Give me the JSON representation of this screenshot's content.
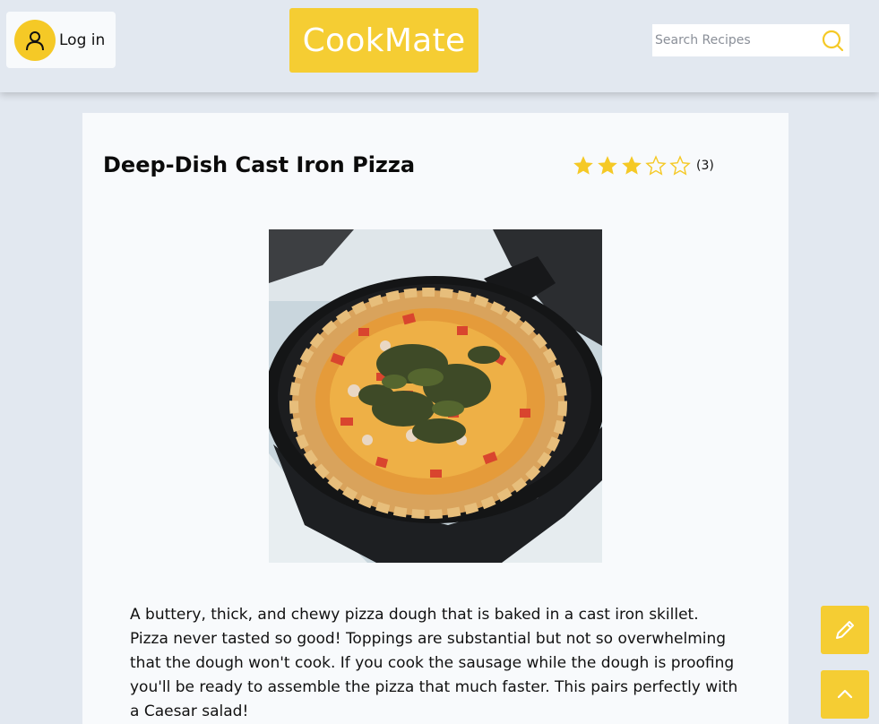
{
  "header": {
    "login_label": "Log in",
    "logo_text": "CookMate",
    "search_placeholder": "Search Recipes",
    "search_value": ""
  },
  "recipe": {
    "title": "Deep-Dish Cast Iron Pizza",
    "rating": 3,
    "rating_max": 5,
    "rating_count": "(3)",
    "image_subject": "deep-dish pizza in cast iron skillet",
    "description": "A buttery, thick, and chewy pizza dough that is baked in a cast iron skillet. Pizza never tasted so good! Toppings are substantial but not so overwhelming that the dough won't cook. If you cook the sausage while the dough is proofing you'll be ready to assemble the pizza that much faster. This pairs perfectly with a Caesar salad!"
  },
  "icons": {
    "login": "user-icon",
    "search": "search-icon",
    "edit": "pencil-icon",
    "scroll_top": "chevron-up-icon",
    "star_filled": "star-filled-icon",
    "star_empty": "star-empty-icon"
  },
  "colors": {
    "accent": "#f5cd33",
    "page_bg": "#e2e8f0",
    "card_bg": "#f8fafc"
  }
}
